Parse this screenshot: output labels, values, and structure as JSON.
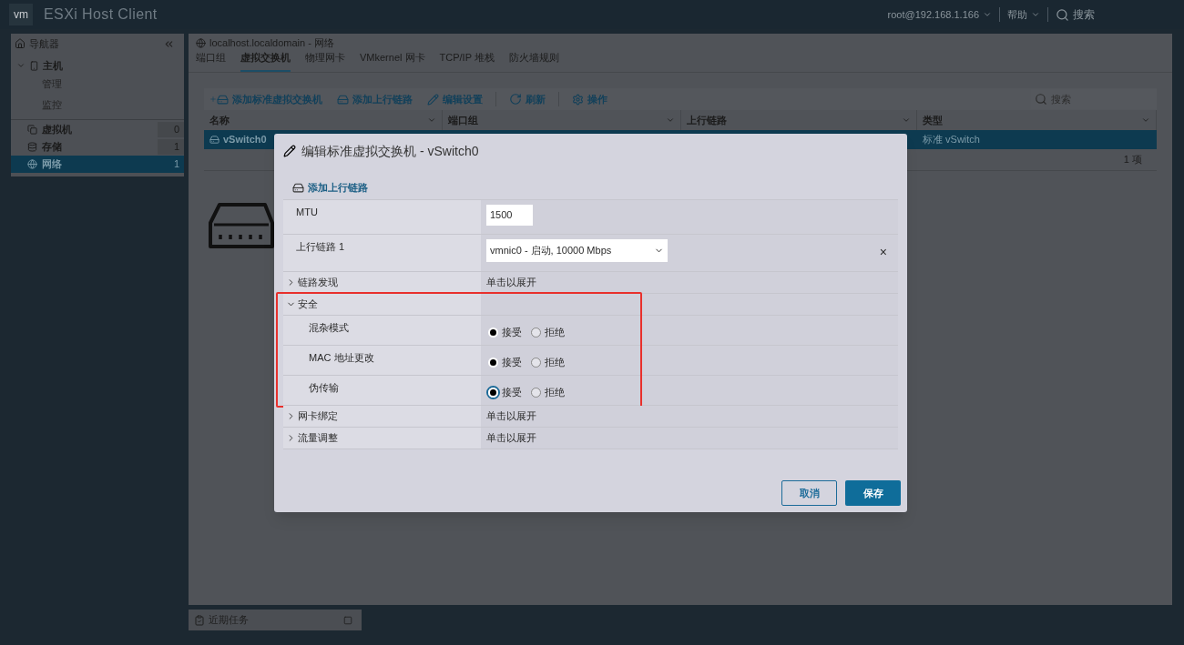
{
  "header": {
    "logo": "vm",
    "title": "ESXi Host Client",
    "user": "root@192.168.1.166",
    "help": "帮助",
    "search": "搜索"
  },
  "navigator": {
    "title": "导航器",
    "host": {
      "label": "主机",
      "expanded": true,
      "children": [
        {
          "label": "管理"
        },
        {
          "label": "监控"
        }
      ]
    },
    "items": [
      {
        "kind": "vm",
        "label": "虚拟机",
        "count": "0",
        "selected": false
      },
      {
        "kind": "storage",
        "label": "存储",
        "count": "1",
        "selected": false
      },
      {
        "kind": "network",
        "label": "网络",
        "count": "1",
        "selected": true
      }
    ]
  },
  "content": {
    "breadcrumb": "localhost.localdomain - 网络",
    "tabs": [
      {
        "label": "端口组",
        "selected": false
      },
      {
        "label": "虚拟交换机",
        "selected": true
      },
      {
        "label": "物理网卡",
        "selected": false
      },
      {
        "label": "VMkernel 网卡",
        "selected": false
      },
      {
        "label": "TCP/IP 堆栈",
        "selected": false
      },
      {
        "label": "防火墙规则",
        "selected": false
      }
    ],
    "toolbar": [
      {
        "kind": "add-switch",
        "label": "添加标准虚拟交换机"
      },
      {
        "kind": "add-uplink",
        "label": "添加上行链路"
      },
      {
        "kind": "edit",
        "label": "编辑设置"
      },
      {
        "kind": "refresh",
        "label": "刷新"
      },
      {
        "kind": "actions",
        "label": "操作"
      }
    ],
    "search_placeholder": "搜索",
    "table": {
      "columns": [
        "名称",
        "端口组",
        "上行链路",
        "类型"
      ],
      "rows": [
        {
          "name": "vSwitch0",
          "type": "标准 vSwitch",
          "selected": true
        }
      ],
      "footer": "1 项"
    }
  },
  "tasks": {
    "label": "近期任务"
  },
  "dialog": {
    "title": "编辑标准虚拟交换机 - vSwitch0",
    "add_uplink": "添加上行链路",
    "rows": [
      {
        "kind": "field",
        "label": "MTU",
        "value": "1500"
      },
      {
        "kind": "select",
        "label": "上行链路 1",
        "value": "vmnic0 - 启动, 10000 Mbps",
        "remove": "×"
      },
      {
        "kind": "section",
        "label": "链路发现",
        "expanded": false,
        "hint": "单击以展开"
      },
      {
        "kind": "section",
        "label": "安全",
        "expanded": true,
        "highlighted": true,
        "children": [
          {
            "label": "混杂模式",
            "options": [
              {
                "label": "接受",
                "selected": true,
                "focused": false
              },
              {
                "label": "拒绝",
                "selected": false,
                "focused": false
              }
            ]
          },
          {
            "label": "MAC 地址更改",
            "options": [
              {
                "label": "接受",
                "selected": true,
                "focused": false
              },
              {
                "label": "拒绝",
                "selected": false,
                "focused": false
              }
            ]
          },
          {
            "label": "伪传输",
            "options": [
              {
                "label": "接受",
                "selected": true,
                "focused": true
              },
              {
                "label": "拒绝",
                "selected": false,
                "focused": false
              }
            ]
          }
        ]
      },
      {
        "kind": "section",
        "label": "网卡绑定",
        "expanded": false,
        "hint": "单击以展开"
      },
      {
        "kind": "section",
        "label": "流量调整",
        "expanded": false,
        "hint": "单击以展开"
      }
    ],
    "buttons": [
      {
        "kind": "secondary",
        "label": "取消"
      },
      {
        "kind": "primary",
        "label": "保存"
      }
    ]
  }
}
